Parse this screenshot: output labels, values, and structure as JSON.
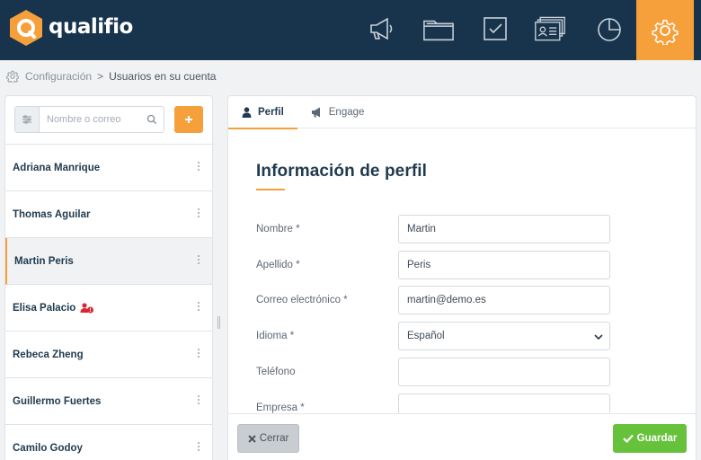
{
  "brand": {
    "name": "qualifio",
    "accent": "#f6a03b",
    "header_bg": "#17344c"
  },
  "nav": {
    "items": [
      {
        "icon": "megaphone-icon"
      },
      {
        "icon": "folder-icon"
      },
      {
        "icon": "checkbox-icon"
      },
      {
        "icon": "contact-card-icon"
      },
      {
        "icon": "pie-chart-icon"
      },
      {
        "icon": "gear-icon",
        "active": true
      }
    ]
  },
  "breadcrumb": {
    "parent": "Configuración",
    "separator": ">",
    "current": "Usuarios en su cuenta"
  },
  "search": {
    "placeholder": "Nombre o correo",
    "value": ""
  },
  "users": [
    {
      "name": "Adriana Manrique"
    },
    {
      "name": "Thomas Aguilar"
    },
    {
      "name": "Martin Peris",
      "active": true
    },
    {
      "name": "Elisa Palacio",
      "alert": true
    },
    {
      "name": "Rebeca Zheng"
    },
    {
      "name": "Guillermo Fuertes"
    },
    {
      "name": "Camilo Godoy"
    }
  ],
  "tabs": [
    {
      "label": "Perfil",
      "icon": "user-icon",
      "active": true
    },
    {
      "label": "Engage",
      "icon": "megaphone-icon"
    }
  ],
  "form": {
    "title": "Información de perfil",
    "fields": [
      {
        "label": "Nombre *",
        "value": "Martin"
      },
      {
        "label": "Apellido *",
        "value": "Peris"
      },
      {
        "label": "Correo electrónico *",
        "value": "martin@demo.es"
      },
      {
        "label": "Idioma *",
        "value": "Español",
        "type": "select"
      },
      {
        "label": "Teléfono",
        "value": ""
      },
      {
        "label": "Empresa *",
        "value": ""
      }
    ]
  },
  "footer": {
    "close_label": "Cerrar",
    "save_label": "Guardar"
  }
}
